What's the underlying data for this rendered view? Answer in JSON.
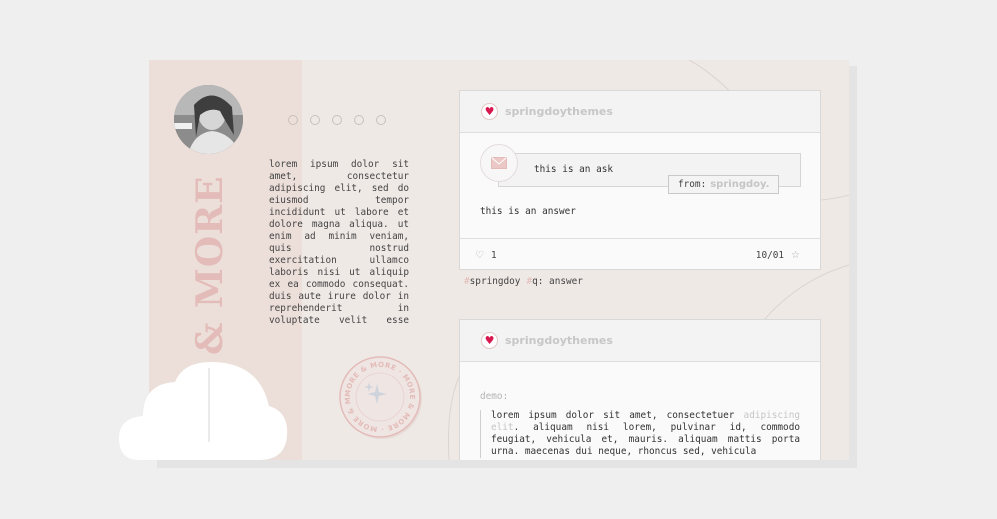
{
  "sidebar": {
    "title": "& MORE",
    "bio": "lorem ipsum dolor sit amet, consectetur adipiscing elit, sed do eiusmod tempor incididunt ut labore et dolore magna aliqua. ut enim ad minim veniam, quis nostrud exercitation ullamco laboris nisi ut aliquip ex ea commodo consequat. duis aute irure dolor in reprehenderit in voluptate velit esse",
    "stamp_text": "MORE & MORE · MORE & MORE · MORE & MORE ·"
  },
  "posts": [
    {
      "blog_name": "springdoythemes",
      "ask_text": "this is an ask",
      "from_label": "from:",
      "from_user": "springdoy.",
      "answer": "this is an answer",
      "likes": "1",
      "date": "10/01",
      "tags": [
        "springdoy",
        "q: answer"
      ]
    },
    {
      "blog_name": "springdoythemes",
      "demo_label": "demo:",
      "quote_start": "lorem ipsum dolor sit amet, consectetuer ",
      "quote_highlight": "adipiscing elit",
      "quote_end": ". aliquam nisi lorem, pulvinar id, commodo feugiat, vehicula et, mauris. aliquam mattis porta urna. maecenas dui neque, rhoncus sed, vehicula"
    }
  ],
  "colors": {
    "accent": "#e3bcb9",
    "heart": "#d8174f",
    "muted": "#c7c7c7"
  },
  "icons": {
    "heart": "heart-icon",
    "mail": "mail-icon",
    "like": "heart-outline-icon",
    "reblog": "star-icon"
  }
}
